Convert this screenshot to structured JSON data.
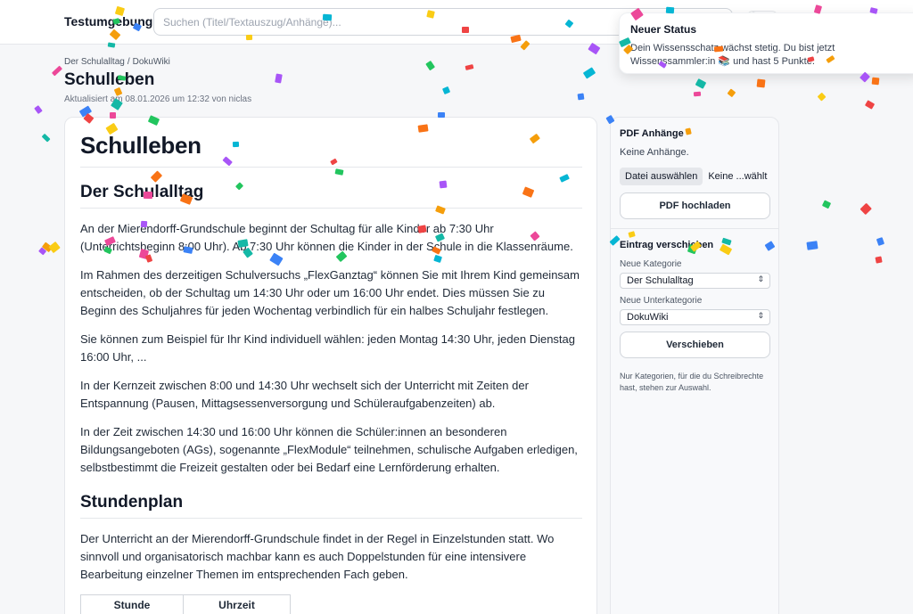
{
  "app": {
    "brand": "Testumgebung"
  },
  "search": {
    "placeholder": "Suchen (Titel/Textauszug/Anhänge)..."
  },
  "breadcrumb": {
    "category": "Der Schulalltag",
    "separator": "/",
    "subcategory": "DokuWiki"
  },
  "page": {
    "title": "Schulleben",
    "updated": "Aktualisiert am 08.01.2026 um 12:32 von niclas"
  },
  "article": {
    "heading": "Schulleben",
    "section1": {
      "heading": "Der Schulalltag",
      "paragraphs": [
        "An der Mierendorff-Grundschule beginnt der Schultag für alle Kinder ab 7:30 Uhr (Unterrichtsbeginn 8:00 Uhr). Ab 7:30 Uhr können die Kinder in der Schule in die Klassenräume.",
        "Im Rahmen des derzeitigen Schulversuchs „FlexGanztag“ können Sie mit Ihrem Kind gemeinsam entscheiden, ob der Schultag um 14:30 Uhr oder um 16:00 Uhr endet. Dies müssen Sie zu Beginn des Schuljahres für jeden Wochentag verbindlich für ein halbes Schuljahr festlegen.",
        "Sie können zum Beispiel für Ihr Kind individuell wählen: jeden Montag 14:30 Uhr, jeden Dienstag 16:00 Uhr, ...",
        "In der Kernzeit zwischen 8:00 und 14:30 Uhr wechselt sich der Unterricht mit Zeiten der Entspannung (Pausen, Mittagsessenversorgung und Schüleraufgabenzeiten) ab.",
        "In der Zeit zwischen 14:30 und 16:00 Uhr können die Schüler:innen an besonderen Bildungsangeboten (AGs), sogenannte „FlexModule“ teilnehmen, schulische Aufgaben erledigen, selbstbestimmt die Freizeit gestalten oder bei Bedarf eine Lernförderung erhalten."
      ]
    },
    "section2": {
      "heading": "Stundenplan",
      "paragraphs": [
        "Der Unterricht an der Mierendorff-Grundschule findet in der Regel in Einzelstunden statt. Wo sinnvoll und organisatorisch machbar kann es auch Doppelstunden für eine intensivere Bearbeitung einzelner Themen im entsprechenden Fach geben."
      ],
      "table_headers": [
        "Stunde",
        "Uhrzeit"
      ]
    }
  },
  "sidebar": {
    "pdf": {
      "heading": "PDF Anhänge",
      "empty": "Keine Anhänge.",
      "file_button": "Datei auswählen",
      "file_status": "Keine ...wählt",
      "upload_button": "PDF hochladen"
    },
    "move": {
      "heading": "Eintrag verschieben",
      "category_label": "Neue Kategorie",
      "category_value": "Der Schulalltag",
      "subcategory_label": "Neue Unterkategorie",
      "subcategory_value": "DokuWiki",
      "move_button": "Verschieben",
      "note": "Nur Kategorien, für die du Schreibrechte hast, stehen zur Auswahl."
    }
  },
  "toast": {
    "title": "Neuer Status",
    "body": "Dein Wissensschatz wächst stetig. Du bist jetzt Wissenssammler:in 📚 und hast 5 Punkte."
  },
  "confetti_colors": [
    "#ef4444",
    "#22c55e",
    "#3b82f6",
    "#f59e0b",
    "#a855f7",
    "#14b8a6",
    "#f97316",
    "#ec4899",
    "#06b6d4",
    "#facc15"
  ]
}
